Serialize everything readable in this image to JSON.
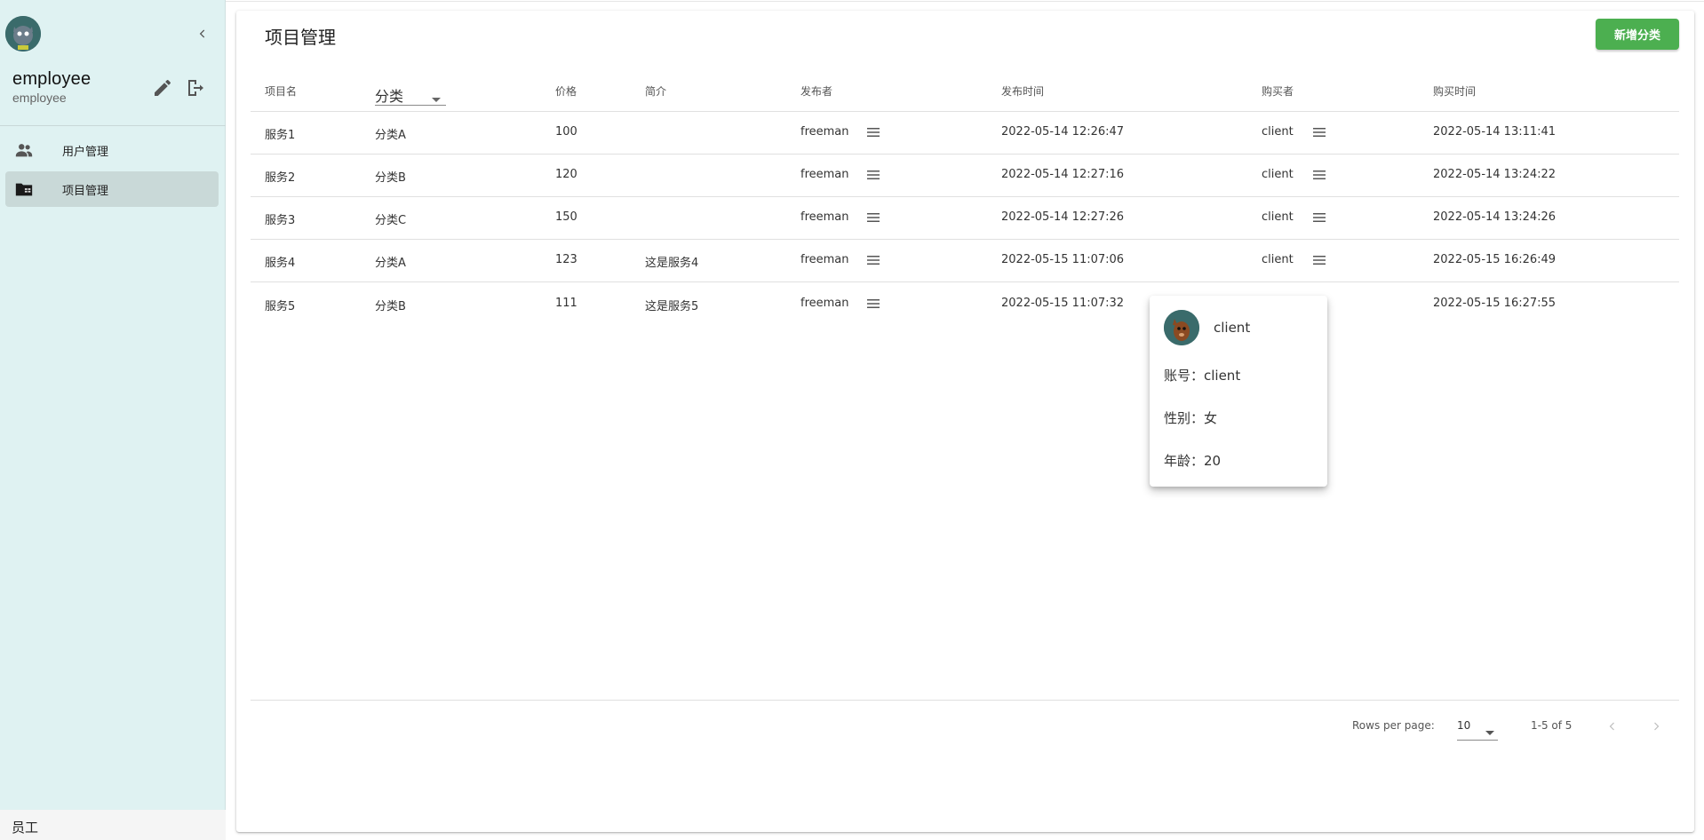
{
  "sidebar": {
    "user_name": "employee",
    "user_role": "employee",
    "nav_items": [
      {
        "label": "用户管理",
        "icon": "users-icon"
      },
      {
        "label": "项目管理",
        "icon": "folder-icon"
      }
    ],
    "footer": "员工"
  },
  "main": {
    "title": "项目管理",
    "add_button": "新增分类",
    "columns": {
      "name": "项目名",
      "category": "分类",
      "price": "价格",
      "intro": "简介",
      "publisher": "发布者",
      "publish_time": "发布时间",
      "buyer": "购买者",
      "buy_time": "购买时间"
    },
    "rows": [
      {
        "name": "服务1",
        "category": "分类A",
        "price": "100",
        "intro": "",
        "publisher": "freeman",
        "publish_time": "2022-05-14 12:26:47",
        "buyer": "client",
        "buy_time": "2022-05-14 13:11:41"
      },
      {
        "name": "服务2",
        "category": "分类B",
        "price": "120",
        "intro": "",
        "publisher": "freeman",
        "publish_time": "2022-05-14 12:27:16",
        "buyer": "client",
        "buy_time": "2022-05-14 13:24:22"
      },
      {
        "name": "服务3",
        "category": "分类C",
        "price": "150",
        "intro": "",
        "publisher": "freeman",
        "publish_time": "2022-05-14 12:27:26",
        "buyer": "client",
        "buy_time": "2022-05-14 13:24:26"
      },
      {
        "name": "服务4",
        "category": "分类A",
        "price": "123",
        "intro": "这是服务4",
        "publisher": "freeman",
        "publish_time": "2022-05-15 11:07:06",
        "buyer": "client",
        "buy_time": "2022-05-15 16:26:49"
      },
      {
        "name": "服务5",
        "category": "分类B",
        "price": "111",
        "intro": "这是服务5",
        "publisher": "freeman",
        "publish_time": "2022-05-15 11:07:32",
        "buyer": "",
        "buy_time": "2022-05-15 16:27:55"
      }
    ],
    "pagination": {
      "rows_per_page_label": "Rows per page:",
      "rows_per_page": "10",
      "range": "1-5 of 5"
    }
  },
  "popup": {
    "name": "client",
    "account": "账号：client",
    "gender": "性别：女",
    "age": "年龄：20"
  },
  "colors": {
    "sidebar_bg": "#dff2f2",
    "active_nav_bg": "#c9d9d8",
    "accent_green": "#4caf50"
  }
}
